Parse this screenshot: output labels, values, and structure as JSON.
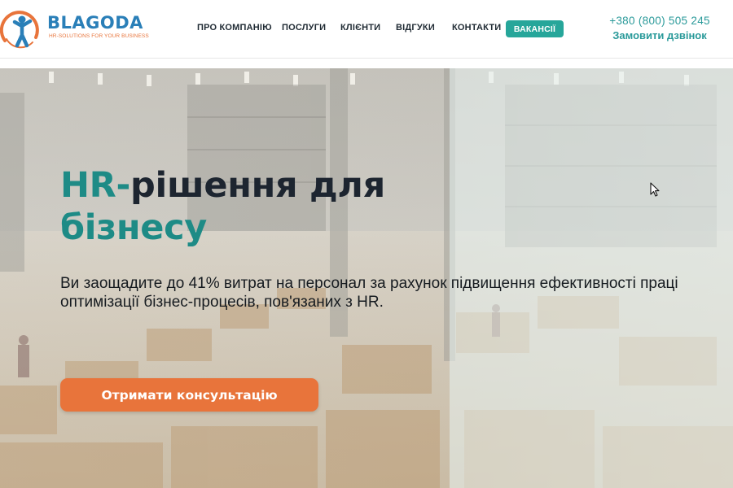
{
  "brand": {
    "name": "BLAGODA",
    "tagline": "HR-SOLUTIONS FOR YOUR BUSINESS",
    "primary_color": "#2a7fb8",
    "accent_color": "#e8743b",
    "teal_color": "#26a69a"
  },
  "nav": {
    "items": [
      {
        "label": "ПРО КОМПАНІЮ"
      },
      {
        "label": "ПОСЛУГИ"
      },
      {
        "label": "КЛІЄНТИ"
      },
      {
        "label": "ВІДГУКИ"
      },
      {
        "label": "КОНТАКТИ"
      }
    ],
    "vacancies_label": "ВАКАНСІЇ"
  },
  "contact": {
    "phone": "+380 (800) 505 245",
    "callback_label": "Замовити дзвінок"
  },
  "hero": {
    "title_part1": "HR-",
    "title_part2": "рішення для",
    "title_part3": "бізнесу",
    "subtitle": "Ви заощадите до 41% витрат на персонал за рахунок підвищення ефективності праці\nоптимізації бізнес-процесів, пов'язаних з HR.",
    "cta_label": "Отримати консультацію",
    "background": "warehouse-photo"
  },
  "icons": {
    "logo": "person-globe-logo-icon",
    "cursor": "mouse-pointer-icon"
  }
}
